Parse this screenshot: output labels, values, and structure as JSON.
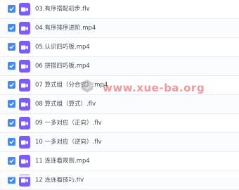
{
  "files": [
    {
      "name": "03.有序搭配初步.flv",
      "checked": true,
      "icon": "video-icon"
    },
    {
      "name": "04.有序排序进阶.mp4",
      "checked": true,
      "icon": "video-icon"
    },
    {
      "name": "05.认识四巧板.mp4",
      "checked": true,
      "icon": "video-icon"
    },
    {
      "name": "06 拼搭四巧板.mp4",
      "checked": true,
      "icon": "video-icon"
    },
    {
      "name": "07 算式组（分合式）.mp4",
      "checked": true,
      "icon": "video-icon"
    },
    {
      "name": "08 算式组（算式）.flv",
      "checked": true,
      "icon": "video-icon"
    },
    {
      "name": "09 一多对应（正向）.flv",
      "checked": true,
      "icon": "video-icon"
    },
    {
      "name": "10 一多对应（逆向）.flv",
      "checked": true,
      "icon": "video-icon"
    },
    {
      "name": "11 连连看规则.mp4",
      "checked": true,
      "icon": "video-icon"
    },
    {
      "name": "12 连连看技巧.flv",
      "checked": true,
      "icon": "video-icon"
    }
  ],
  "watermark": {
    "text": "www.xue-ba.org",
    "color": "#eb4646"
  },
  "colors": {
    "checkbox": "#3d8bfd",
    "file_icon": "#7c5cff"
  }
}
